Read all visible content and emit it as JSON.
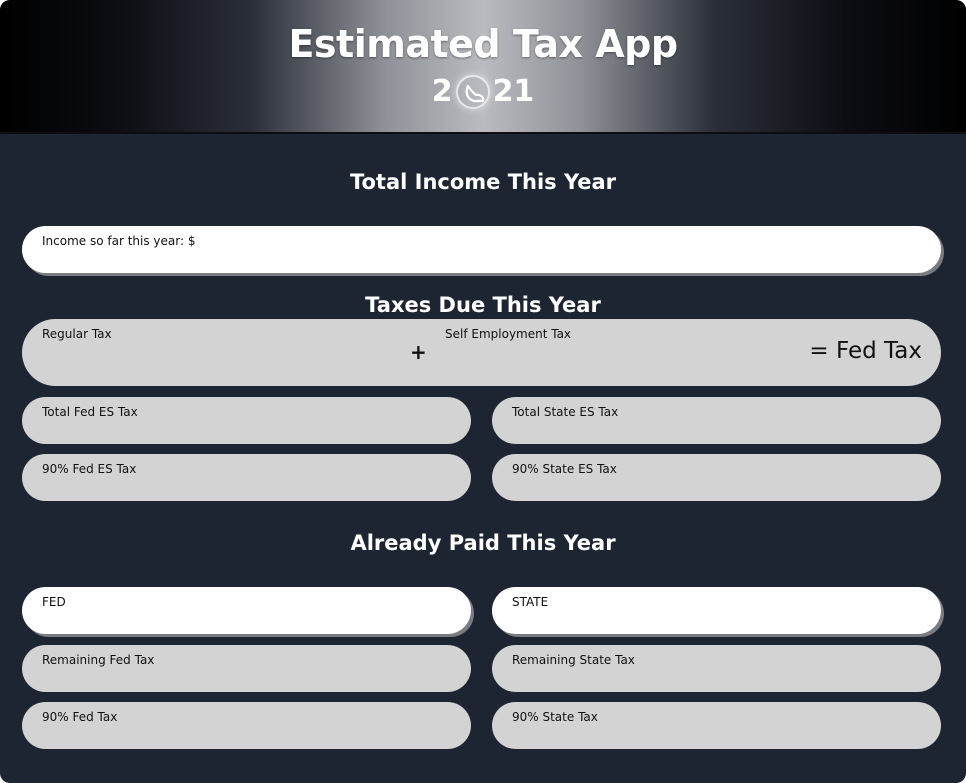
{
  "header": {
    "title": "Estimated Tax App",
    "year_prefix": "2",
    "year_suffix": "21"
  },
  "income": {
    "section_title": "Total Income This Year",
    "income_label": "Income so far this year: $"
  },
  "taxes_due": {
    "section_title": "Taxes Due This Year",
    "regular_tax_label": "Regular Tax",
    "plus_sign": "+",
    "self_employment_label": "Self Employment Tax",
    "fed_tax_result": "= Fed Tax",
    "total_fed_es_label": "Total Fed ES Tax",
    "total_state_es_label": "Total State ES Tax",
    "fed_es_90_label": "90% Fed ES Tax",
    "state_es_90_label": "90% State ES Tax"
  },
  "already_paid": {
    "section_title": "Already Paid This Year",
    "fed_label": "FED",
    "state_label": "STATE",
    "remaining_fed_label": "Remaining Fed Tax",
    "remaining_state_label": "Remaining State Tax",
    "fed_90_label": "90% Fed Tax",
    "state_90_label": "90% State Tax"
  },
  "colors": {
    "background": "#1e2532",
    "editable_field": "#ffffff",
    "readonly_field": "#d3d3d3"
  },
  "icons": {
    "logo": "moon-slice-icon"
  }
}
